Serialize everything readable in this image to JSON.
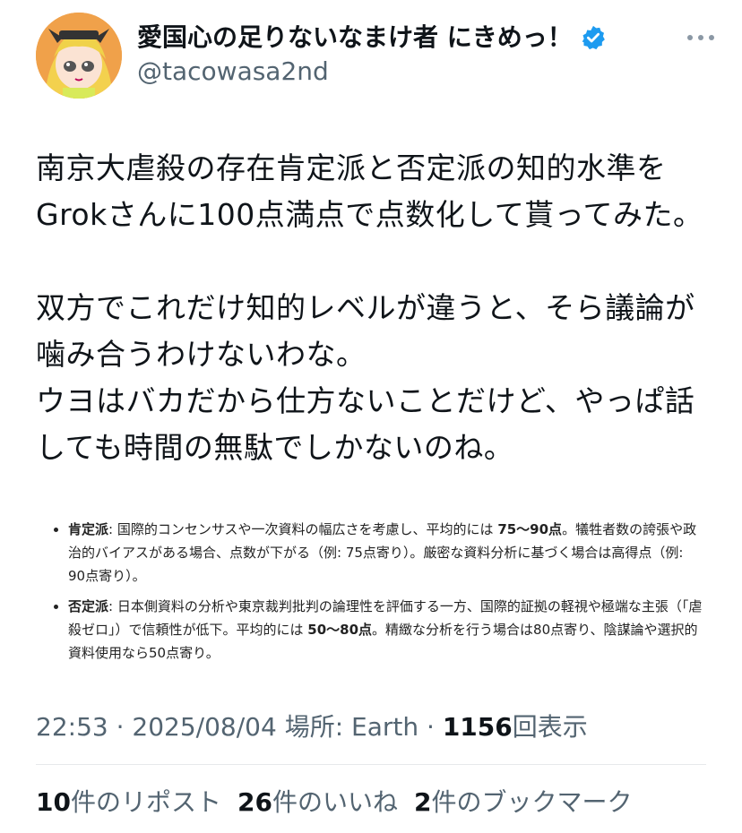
{
  "header": {
    "display_name": "愛国心の足りないなまけ者 にきめっ！",
    "handle": "@tacowasa2nd",
    "verified_icon": "verified-badge-icon",
    "more_icon": "more-icon",
    "avatar_icon": "anime-avatar"
  },
  "tweet": {
    "text": "南京大虐殺の存在肯定派と否定派の知的水準を\nGrokさんに100点満点で点数化して貰ってみた。\n\n双方でこれだけ知的レベルが違うと、そら議論が\n噛み合うわけないわな。\nウヨはバカだから仕方ないことだけど、やっぱ話\nしても時間の無駄でしかないのね。"
  },
  "embed": {
    "items": [
      {
        "label": "肯定派",
        "pre": ": 国際的コンセンサスや一次資料の幅広さを考慮し、平均的には ",
        "bold": "75～90点",
        "post": "。犠牲者数の誇張や政治的バイアスがある場合、点数が下がる（例: 75点寄り）。厳密な資料分析に基づく場合は高得点（例: 90点寄り）。"
      },
      {
        "label": "否定派",
        "pre": ": 日本側資料の分析や東京裁判批判の論理性を評価する一方、国際的証拠の軽視や極端な主張（「虐殺ゼロ」）で信頼性が低下。平均的には ",
        "bold": "50～80点",
        "post": "。精緻な分析を行う場合は80点寄り、陰謀論や選択的資料使用なら50点寄り。"
      }
    ]
  },
  "meta": {
    "time": "22:53",
    "sep1": " · ",
    "date": "2025/08/04",
    "location": " 場所: Earth",
    "sep2": " · ",
    "views_count": "1156",
    "views_label": "回表示"
  },
  "stats": {
    "reposts_count": "10",
    "reposts_label": "件のリポスト",
    "likes_count": "26",
    "likes_label": "件のいいね",
    "bookmarks_count": "2",
    "bookmarks_label": "件のブックマーク"
  },
  "colors": {
    "accent": "#1d9bf0",
    "muted": "#536471",
    "text": "#0f1419"
  }
}
